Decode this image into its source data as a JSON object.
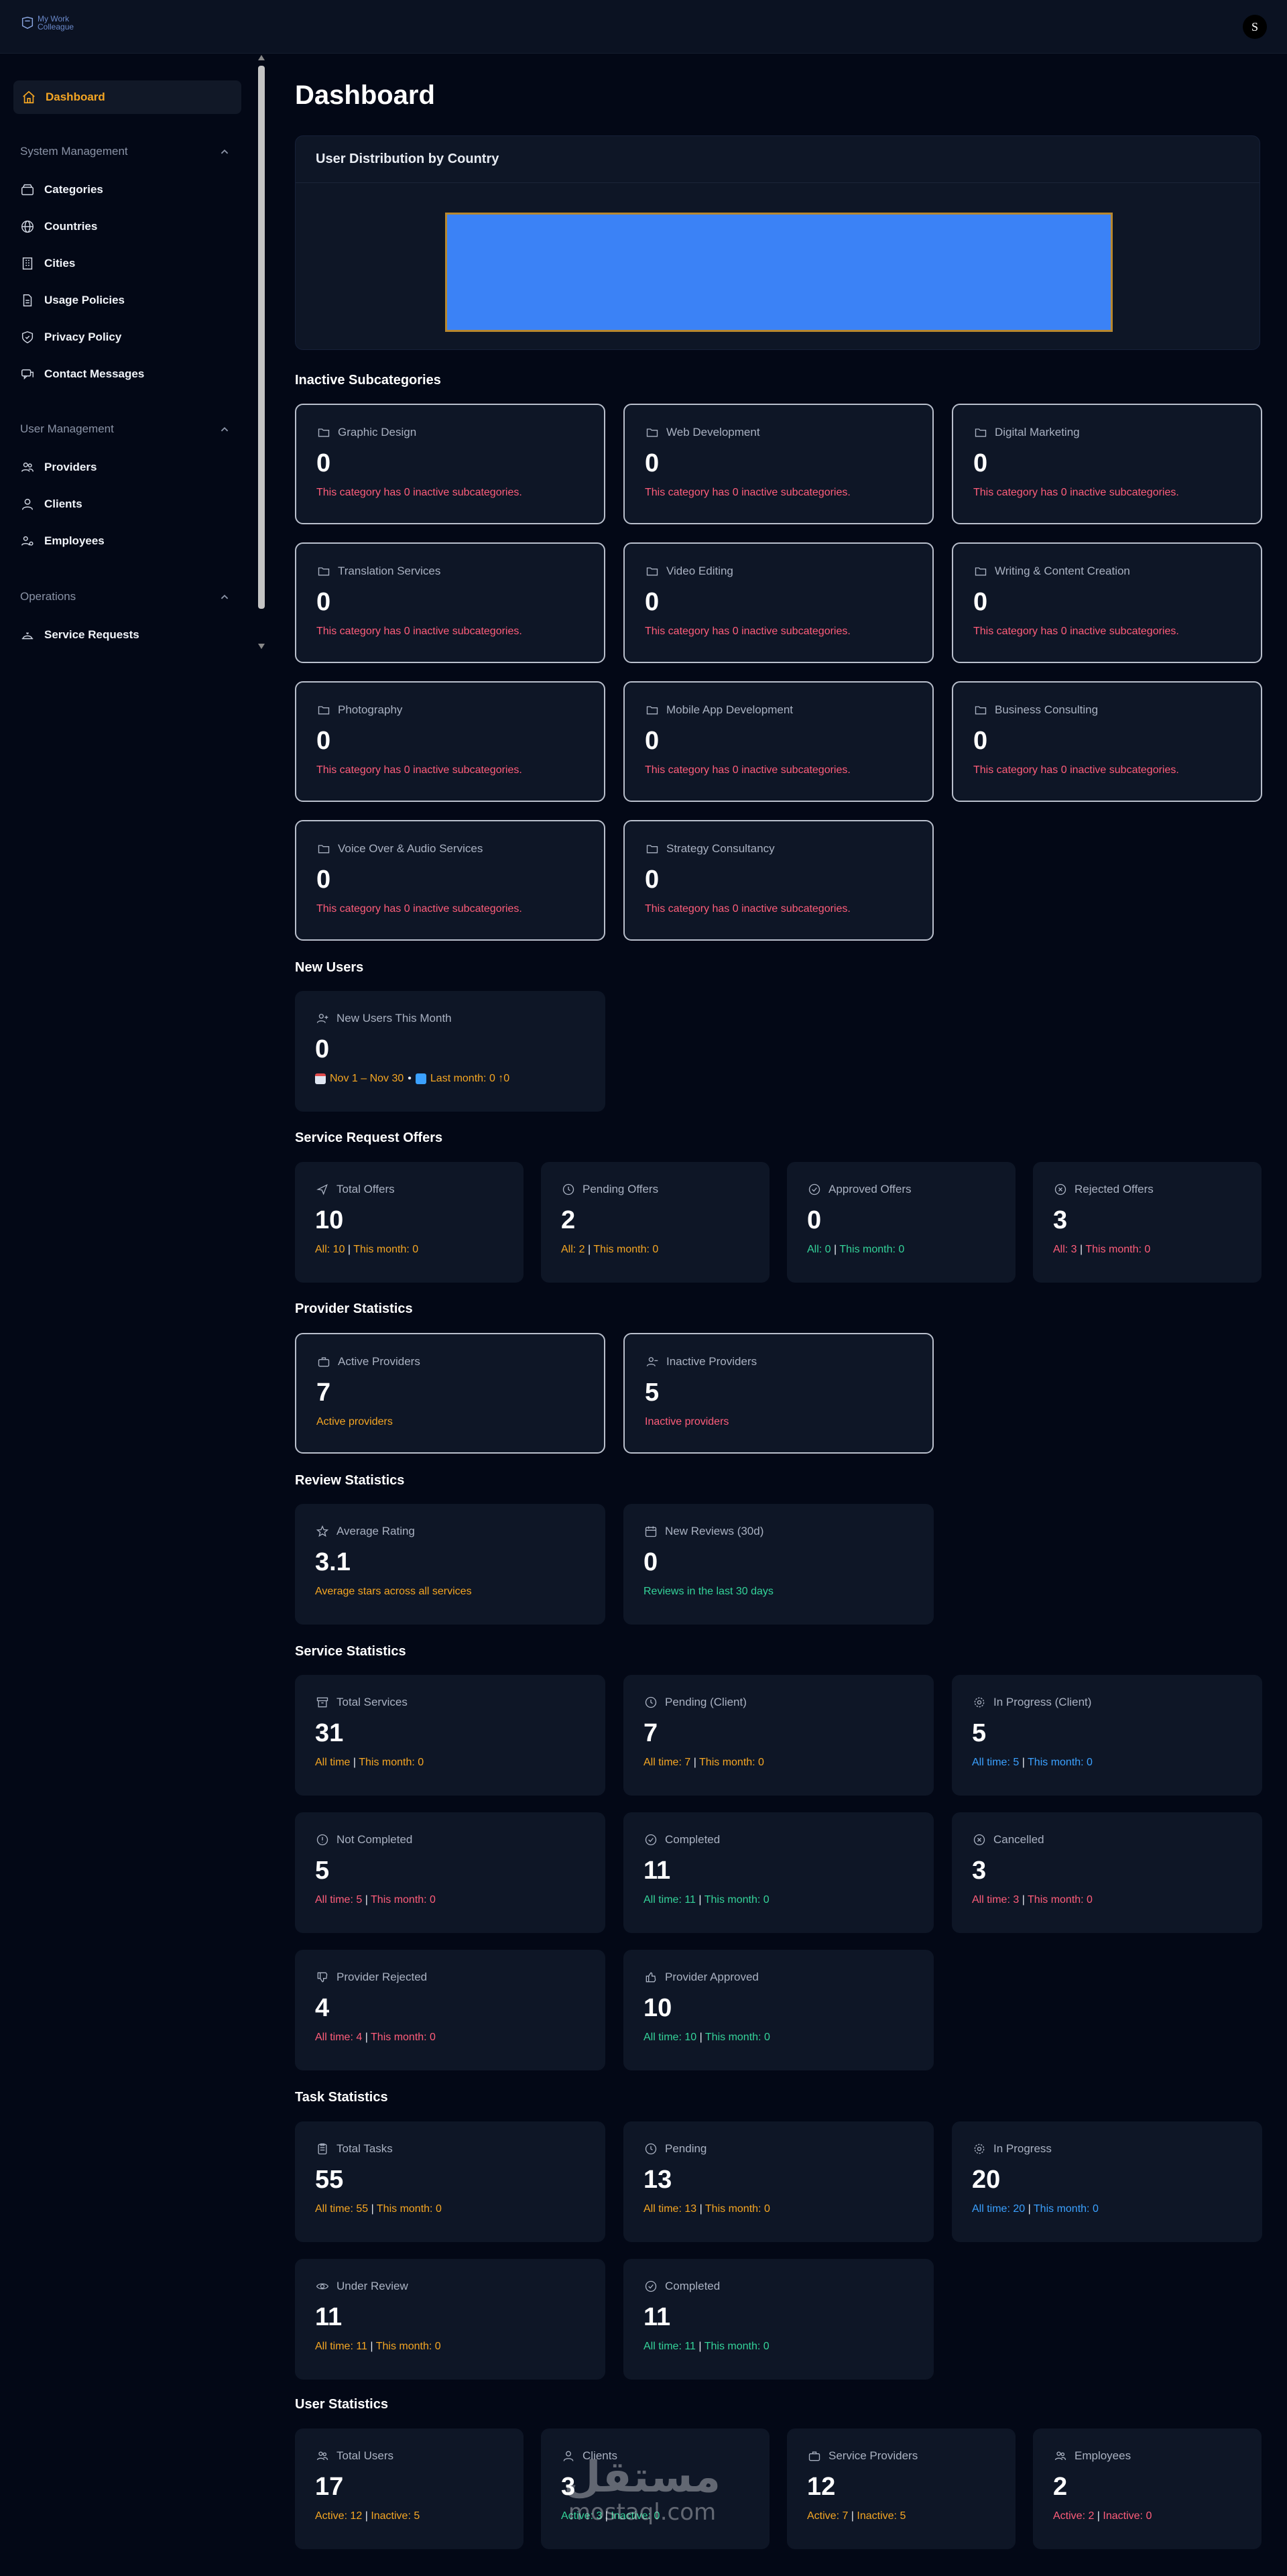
{
  "app": {
    "logo_text": "My Work\nColleague",
    "avatar_initial": "S"
  },
  "sidebar": {
    "active": "Dashboard",
    "sections": [
      {
        "title": "System Management",
        "items": [
          "Categories",
          "Countries",
          "Cities",
          "Usage Policies",
          "Privacy Policy",
          "Contact Messages"
        ]
      },
      {
        "title": "User Management",
        "items": [
          "Providers",
          "Clients",
          "Employees"
        ]
      },
      {
        "title": "Operations",
        "items": [
          "Service Requests"
        ]
      }
    ]
  },
  "page": {
    "title": "Dashboard"
  },
  "distribution": {
    "title": "User Distribution by Country",
    "bar_color": "#3b82f6"
  },
  "inactive_subcategories": {
    "title": "Inactive Subcategories",
    "items": [
      {
        "label": "Graphic Design",
        "value": "0",
        "note": "This category has 0 inactive subcategories."
      },
      {
        "label": "Web Development",
        "value": "0",
        "note": "This category has 0 inactive subcategories."
      },
      {
        "label": "Digital Marketing",
        "value": "0",
        "note": "This category has 0 inactive subcategories."
      },
      {
        "label": "Translation Services",
        "value": "0",
        "note": "This category has 0 inactive subcategories."
      },
      {
        "label": "Video Editing",
        "value": "0",
        "note": "This category has 0 inactive subcategories."
      },
      {
        "label": "Writing & Content Creation",
        "value": "0",
        "note": "This category has 0 inactive subcategories."
      },
      {
        "label": "Photography",
        "value": "0",
        "note": "This category has 0 inactive subcategories."
      },
      {
        "label": "Mobile App Development",
        "value": "0",
        "note": "This category has 0 inactive subcategories."
      },
      {
        "label": "Business Consulting",
        "value": "0",
        "note": "This category has 0 inactive subcategories."
      },
      {
        "label": "Voice Over & Audio Services",
        "value": "0",
        "note": "This category has 0 inactive subcategories."
      },
      {
        "label": "Strategy Consultancy",
        "value": "0",
        "note": "This category has 0 inactive subcategories."
      }
    ]
  },
  "new_users": {
    "title": "New Users",
    "label": "New Users This Month",
    "value": "0",
    "range": "Nov 1 – Nov 30",
    "last_month": "Last month: 0 ↑0"
  },
  "offers": {
    "title": "Service Request Offers",
    "items": [
      {
        "label": "Total Offers",
        "value": "10",
        "a": "All: 10",
        "b": "This month: 0",
        "color": "orange"
      },
      {
        "label": "Pending Offers",
        "value": "2",
        "a": "All: 2",
        "b": "This month: 0",
        "color": "orange"
      },
      {
        "label": "Approved Offers",
        "value": "0",
        "a": "All: 0",
        "b": "This month: 0",
        "color": "green"
      },
      {
        "label": "Rejected Offers",
        "value": "3",
        "a": "All: 3",
        "b": "This month: 0",
        "color": "red"
      }
    ]
  },
  "providers": {
    "title": "Provider Statistics",
    "items": [
      {
        "label": "Active Providers",
        "value": "7",
        "note": "Active providers",
        "color": "orange"
      },
      {
        "label": "Inactive Providers",
        "value": "5",
        "note": "Inactive providers",
        "color": "red"
      }
    ]
  },
  "reviews": {
    "title": "Review Statistics",
    "items": [
      {
        "label": "Average Rating",
        "value": "3.1",
        "note": "Average stars across all services",
        "color": "orange"
      },
      {
        "label": "New Reviews (30d)",
        "value": "0",
        "note": "Reviews in the last 30 days",
        "color": "green"
      }
    ]
  },
  "services": {
    "title": "Service Statistics",
    "items": [
      {
        "label": "Total Services",
        "value": "31",
        "a": "All time",
        "b": "This month: 0",
        "color": "orange"
      },
      {
        "label": "Pending (Client)",
        "value": "7",
        "a": "All time: 7",
        "b": "This month: 0",
        "color": "orange"
      },
      {
        "label": "In Progress (Client)",
        "value": "5",
        "a": "All time: 5",
        "b": "This month: 0",
        "color": "blue"
      },
      {
        "label": "Not Completed",
        "value": "5",
        "a": "All time: 5",
        "b": "This month: 0",
        "color": "red"
      },
      {
        "label": "Completed",
        "value": "11",
        "a": "All time: 11",
        "b": "This month: 0",
        "color": "green"
      },
      {
        "label": "Cancelled",
        "value": "3",
        "a": "All time: 3",
        "b": "This month: 0",
        "color": "red"
      },
      {
        "label": "Provider Rejected",
        "value": "4",
        "a": "All time: 4",
        "b": "This month: 0",
        "color": "red"
      },
      {
        "label": "Provider Approved",
        "value": "10",
        "a": "All time: 10",
        "b": "This month: 0",
        "color": "green"
      }
    ]
  },
  "tasks": {
    "title": "Task Statistics",
    "items": [
      {
        "label": "Total Tasks",
        "value": "55",
        "a": "All time: 55",
        "b": "This month: 0",
        "color": "orange"
      },
      {
        "label": "Pending",
        "value": "13",
        "a": "All time: 13",
        "b": "This month: 0",
        "color": "orange"
      },
      {
        "label": "In Progress",
        "value": "20",
        "a": "All time: 20",
        "b": "This month: 0",
        "color": "blue"
      },
      {
        "label": "Under Review",
        "value": "11",
        "a": "All time: 11",
        "b": "This month: 0",
        "color": "orange"
      },
      {
        "label": "Completed",
        "value": "11",
        "a": "All time: 11",
        "b": "This month: 0",
        "color": "green"
      }
    ]
  },
  "users": {
    "title": "User Statistics",
    "items": [
      {
        "label": "Total Users",
        "value": "17",
        "a": "Active: 12",
        "b": "Inactive: 5",
        "color": "orange"
      },
      {
        "label": "Clients",
        "value": "3",
        "a": "Active: 3",
        "b": "Inactive: 0",
        "color": "green"
      },
      {
        "label": "Service Providers",
        "value": "12",
        "a": "Active: 7",
        "b": "Inactive: 5",
        "color": "orange"
      },
      {
        "label": "Employees",
        "value": "2",
        "a": "Active: 2",
        "b": "Inactive: 0",
        "color": "red"
      }
    ]
  },
  "watermark": {
    "arabic": "مستقل",
    "latin": "mostaql.com"
  }
}
